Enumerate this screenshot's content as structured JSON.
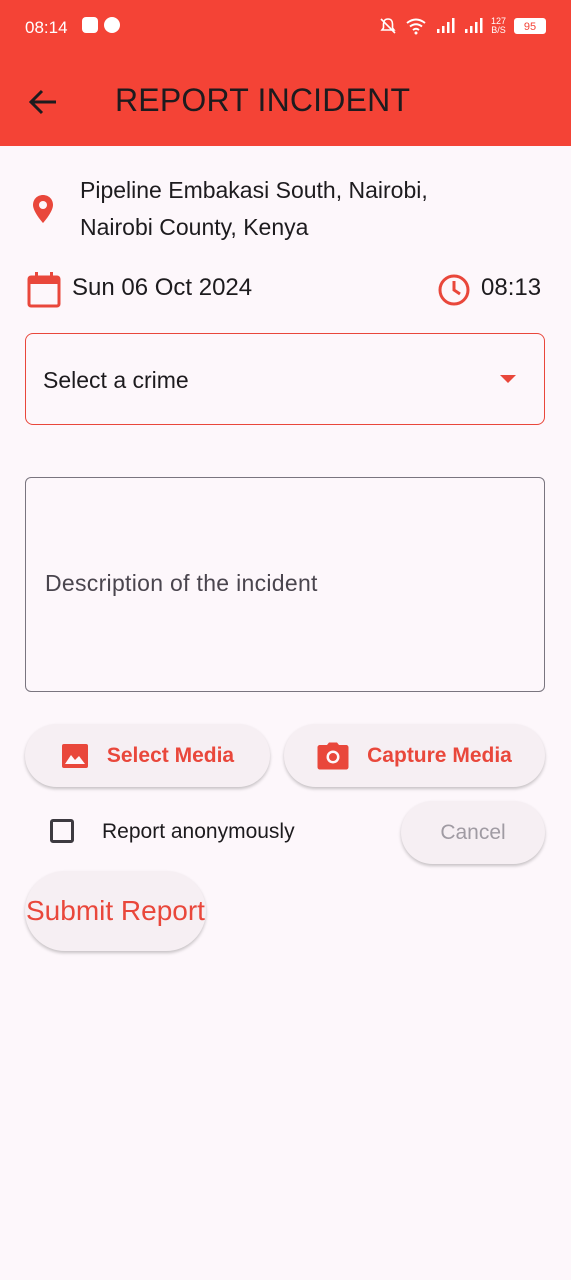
{
  "status_bar": {
    "time": "08:14",
    "network_speed_top": "127",
    "network_speed_bottom": "B/S",
    "battery": "95",
    "icons": [
      "bag-icon",
      "chat-bubble-icon",
      "mute-bell-icon",
      "wifi-icon",
      "signal-icon",
      "signal-icon",
      "battery-icon"
    ]
  },
  "app_bar": {
    "title": "REPORT INCIDENT",
    "back_icon": "arrow-left-icon",
    "background": "#f44336"
  },
  "location": {
    "icon": "map-pin-icon",
    "text": "Pipeline Embakasi South, Nairobi, Nairobi County, Kenya"
  },
  "datetime": {
    "date_icon": "calendar-icon",
    "date": "Sun 06 Oct 2024",
    "time_icon": "clock-icon",
    "time": "08:13"
  },
  "crime_select": {
    "label": "Select a crime",
    "icon": "dropdown-arrow-icon"
  },
  "description": {
    "placeholder": "Description of the incident"
  },
  "media": {
    "select_label": "Select Media",
    "select_icon": "image-icon",
    "capture_label": "Capture Media",
    "capture_icon": "camera-icon"
  },
  "anonymous": {
    "label": "Report anonymously",
    "checked": false
  },
  "actions": {
    "cancel_label": "Cancel",
    "submit_label": "Submit Report"
  },
  "colors": {
    "accent": "#e9473b",
    "background": "#fdf7fb",
    "button_bg": "#f6eff3"
  }
}
